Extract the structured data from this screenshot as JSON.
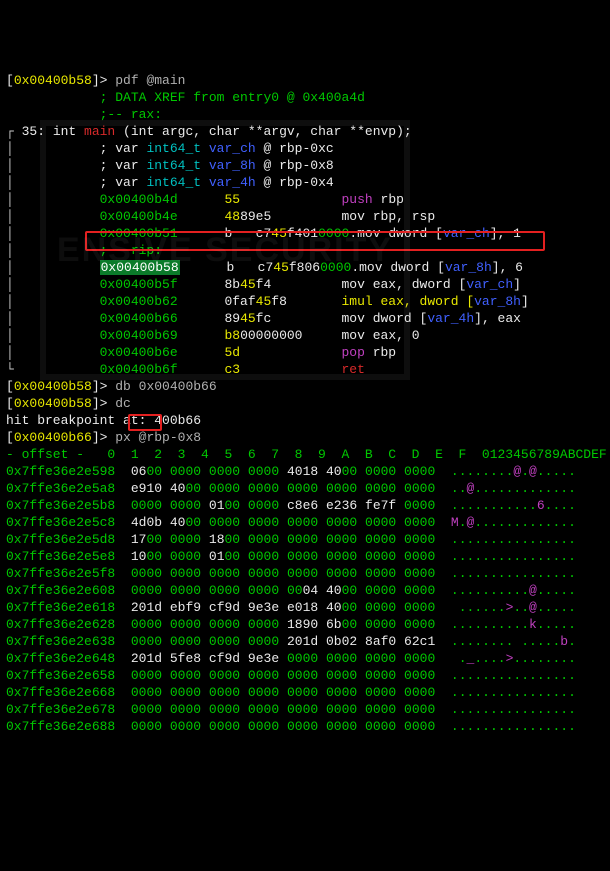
{
  "prompt_addr1": "0x00400b58",
  "prompt_addr2": "0x00400b66",
  "cmd_pdf": "pdf @main",
  "cmd_db": "db 0x00400b66",
  "cmd_dc": "dc",
  "cmd_px": "px @rbp-0x8",
  "xref": "; DATA XREF from entry0 @ 0x400a4d",
  "rax_comment": ";-- rax:",
  "func_sig_prefix": "35: int ",
  "func_name": "main",
  "func_args": " (int argc, char **argv, char **envp);",
  "vars": [
    {
      "type": "int64_t",
      "name": "var_ch",
      "loc": "rbp-0xc"
    },
    {
      "type": "int64_t",
      "name": "var_8h",
      "loc": "rbp-0x8"
    },
    {
      "type": "int64_t",
      "name": "var_4h",
      "loc": "rbp-0x4"
    }
  ],
  "rip_comment": ";-- rip:",
  "asm": [
    {
      "addr": "0x00400b4d",
      "b1": "55",
      "b2": "",
      "op": "push",
      "args": "rbp",
      "c": "mag"
    },
    {
      "addr": "0x00400b4e",
      "b1": "48",
      "b2": "89e5",
      "op": "mov",
      "args": "rbp, rsp",
      "c": "wht"
    },
    {
      "addr": "0x00400b51",
      "b1": "",
      "bpre": "b   c7",
      "b2": "45",
      "b3": "f401",
      "b4": "0000",
      "op": "mov dword [",
      "var": "var_ch",
      "tail": "], 1",
      "c": "wht",
      "period": "."
    },
    {
      "addr": "0x00400b58",
      "b1": "",
      "bpre": "b   c7",
      "b2": "45",
      "b3": "f806",
      "b4": "0000",
      "op": "mov dword [",
      "var": "var_8h",
      "tail": "], 6",
      "c": "wht",
      "hl": true,
      "period": "."
    },
    {
      "addr": "0x00400b5f",
      "b1": "8b",
      "b2": "45",
      "b3": "f4",
      "op": "mov eax, dword [",
      "var": "var_ch",
      "tail": "]",
      "c": "wht"
    },
    {
      "addr": "0x00400b62",
      "b1": "0faf",
      "b2": "45",
      "b3": "f8",
      "op": "imul eax, dword [",
      "var": "var_8h",
      "tail": "]",
      "c": "yel"
    },
    {
      "addr": "0x00400b66",
      "b1": "89",
      "b2": "45",
      "b3": "fc",
      "op": "mov dword [",
      "var": "var_4h",
      "tail": "], eax",
      "c": "wht"
    },
    {
      "addr": "0x00400b69",
      "b1": "b8",
      "b2": "00000000",
      "op": "mov",
      "args": "eax, 0",
      "c": "wht"
    },
    {
      "addr": "0x00400b6e",
      "b1": "5d",
      "b2": "",
      "op": "pop",
      "args": "rbp",
      "c": "mag"
    },
    {
      "addr": "0x00400b6f",
      "b1": "c3",
      "b2": "",
      "op": "ret",
      "args": "",
      "c": "red"
    }
  ],
  "bp_msg": "hit breakpoint at: 400b66",
  "hex_header_offset": "- offset -",
  "hex_header_cols": "0  1  2  3  4  5  6  7  8  9  A  B  C  D  E  F",
  "hex_header_ascii": "0123456789ABCDEF",
  "hex_rows": [
    {
      "addr": "0x7ffe36e2e598",
      "cols": [
        "0600",
        "0000",
        "0000",
        "0000",
        "4018",
        "4000",
        "0000",
        "0000"
      ],
      "ascii": "........@.@....."
    },
    {
      "addr": "0x7ffe36e2e5a8",
      "cols": [
        "e910",
        "4000",
        "0000",
        "0000",
        "0000",
        "0000",
        "0000",
        "0000"
      ],
      "ascii": "..@............."
    },
    {
      "addr": "0x7ffe36e2e5b8",
      "cols": [
        "0000",
        "0000",
        "0100",
        "0000",
        "c8e6",
        "e236",
        "fe7f",
        "0000"
      ],
      "ascii": "...........6...."
    },
    {
      "addr": "0x7ffe36e2e5c8",
      "cols": [
        "4d0b",
        "4000",
        "0000",
        "0000",
        "0000",
        "0000",
        "0000",
        "0000"
      ],
      "ascii": "M.@............."
    },
    {
      "addr": "0x7ffe36e2e5d8",
      "cols": [
        "1700",
        "0000",
        "1800",
        "0000",
        "0000",
        "0000",
        "0000",
        "0000"
      ],
      "ascii": "................"
    },
    {
      "addr": "0x7ffe36e2e5e8",
      "cols": [
        "1000",
        "0000",
        "0100",
        "0000",
        "0000",
        "0000",
        "0000",
        "0000"
      ],
      "ascii": "................"
    },
    {
      "addr": "0x7ffe36e2e5f8",
      "cols": [
        "0000",
        "0000",
        "0000",
        "0000",
        "0000",
        "0000",
        "0000",
        "0000"
      ],
      "ascii": "................"
    },
    {
      "addr": "0x7ffe36e2e608",
      "cols": [
        "0000",
        "0000",
        "0000",
        "0000",
        "0004",
        "4000",
        "0000",
        "0000"
      ],
      "ascii": "..........@....."
    },
    {
      "addr": "0x7ffe36e2e618",
      "cols": [
        "201d",
        "ebf9",
        "cf9d",
        "9e3e",
        "e018",
        "4000",
        "0000",
        "0000"
      ],
      "ascii": " ......>..@....."
    },
    {
      "addr": "0x7ffe36e2e628",
      "cols": [
        "0000",
        "0000",
        "0000",
        "0000",
        "1890",
        "6b00",
        "0000",
        "0000"
      ],
      "ascii": "..........k....."
    },
    {
      "addr": "0x7ffe36e2e638",
      "cols": [
        "0000",
        "0000",
        "0000",
        "0000",
        "201d",
        "0b02",
        "8af0",
        "62c1"
      ],
      "ascii": "........ .....b."
    },
    {
      "addr": "0x7ffe36e2e648",
      "cols": [
        "201d",
        "5fe8",
        "cf9d",
        "9e3e",
        "0000",
        "0000",
        "0000",
        "0000"
      ],
      "ascii": " ._....>........"
    },
    {
      "addr": "0x7ffe36e2e658",
      "cols": [
        "0000",
        "0000",
        "0000",
        "0000",
        "0000",
        "0000",
        "0000",
        "0000"
      ],
      "ascii": "................"
    },
    {
      "addr": "0x7ffe36e2e668",
      "cols": [
        "0000",
        "0000",
        "0000",
        "0000",
        "0000",
        "0000",
        "0000",
        "0000"
      ],
      "ascii": "................"
    },
    {
      "addr": "0x7ffe36e2e678",
      "cols": [
        "0000",
        "0000",
        "0000",
        "0000",
        "0000",
        "0000",
        "0000",
        "0000"
      ],
      "ascii": "................"
    },
    {
      "addr": "0x7ffe36e2e688",
      "cols": [
        "0000",
        "0000",
        "0000",
        "0000",
        "0000",
        "0000",
        "0000",
        "0000"
      ],
      "ascii": "................"
    }
  ],
  "watermark": "ENSIVE SECURITY"
}
